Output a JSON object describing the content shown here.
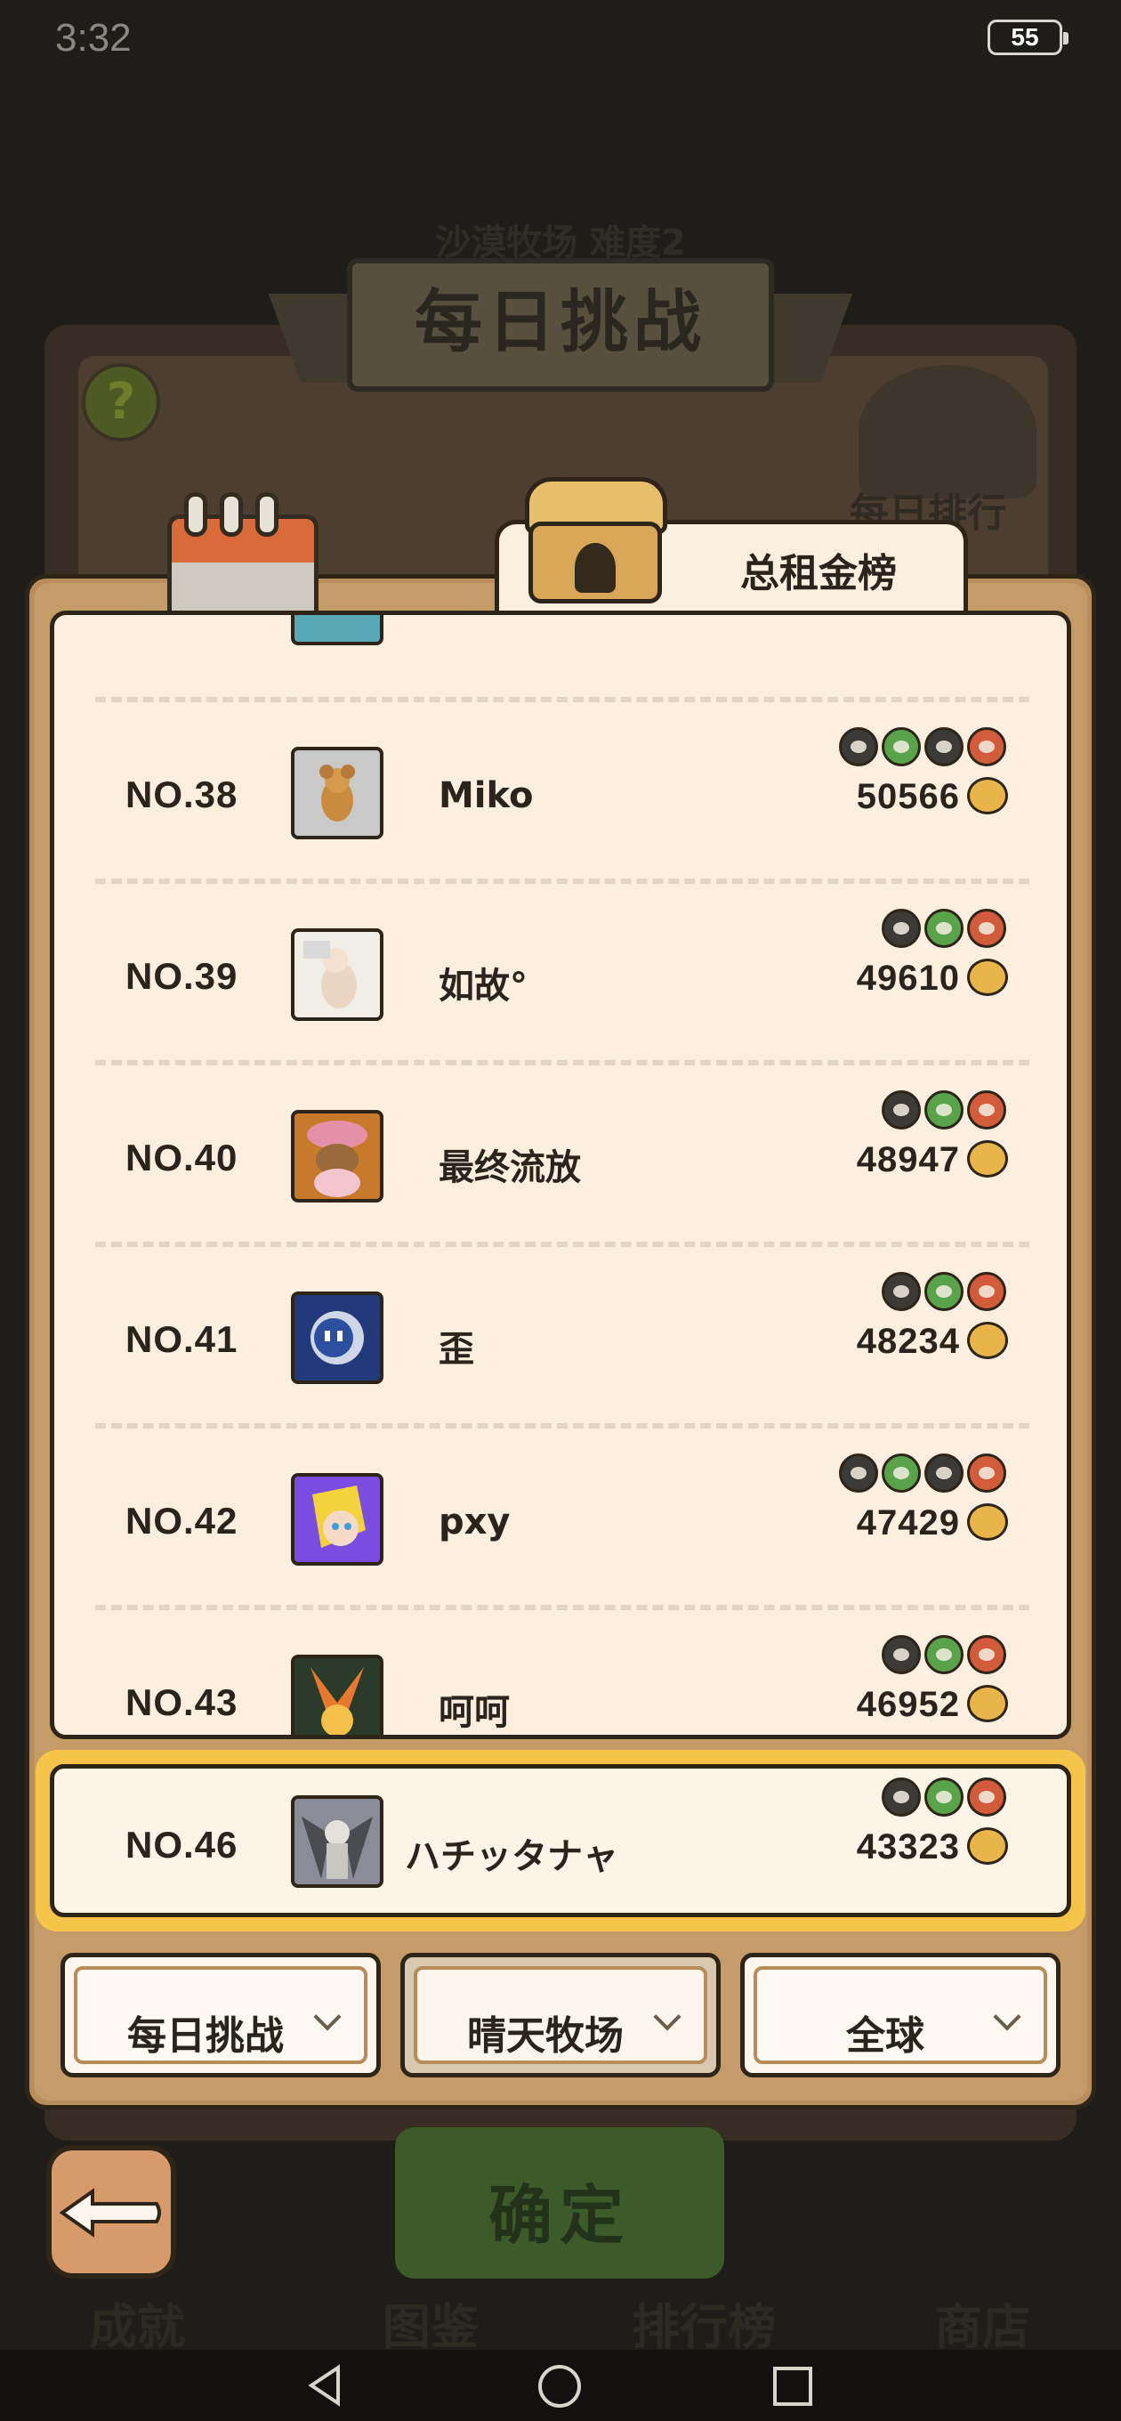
{
  "status_bar": {
    "time": "3:32",
    "battery": "55"
  },
  "background": {
    "top_text": "沙漠牧场 难度2",
    "title": "每日挑战",
    "daily_rank_label": "每日排行",
    "help_symbol": "?",
    "confirm_label": "确定",
    "bottom_labels": [
      "成就",
      "图鉴",
      "排行榜",
      "商店"
    ]
  },
  "leaderboard": {
    "tab_label": "总租金榜",
    "rows": [
      {
        "rank": "NO.38",
        "name": "Miko",
        "score": "50566",
        "icons": [
          "b",
          "g",
          "b",
          "r"
        ]
      },
      {
        "rank": "NO.39",
        "name": "如故°",
        "score": "49610",
        "icons": [
          "b",
          "g",
          "r"
        ]
      },
      {
        "rank": "NO.40",
        "name": "最终流放",
        "score": "48947",
        "icons": [
          "b",
          "g",
          "r"
        ]
      },
      {
        "rank": "NO.41",
        "name": "歪",
        "score": "48234",
        "icons": [
          "b",
          "g",
          "r"
        ]
      },
      {
        "rank": "NO.42",
        "name": "pxy",
        "score": "47429",
        "icons": [
          "b",
          "g",
          "b",
          "r"
        ]
      },
      {
        "rank": "NO.43",
        "name": "呵呵",
        "score": "46952",
        "icons": [
          "b",
          "g",
          "r"
        ]
      }
    ],
    "own": {
      "rank": "NO.46",
      "name": "ハチッタナャ",
      "score": "43323",
      "icons": [
        "b",
        "g",
        "r"
      ]
    }
  },
  "filters": [
    {
      "label": "每日挑战"
    },
    {
      "label": "晴天牧场"
    },
    {
      "label": "全球"
    }
  ],
  "colors": {
    "board": "#b98d5c",
    "panel": "#fcefdf",
    "highlight": "#f4c549",
    "green_icon": "#59a34a",
    "red_icon": "#d25b3b"
  }
}
